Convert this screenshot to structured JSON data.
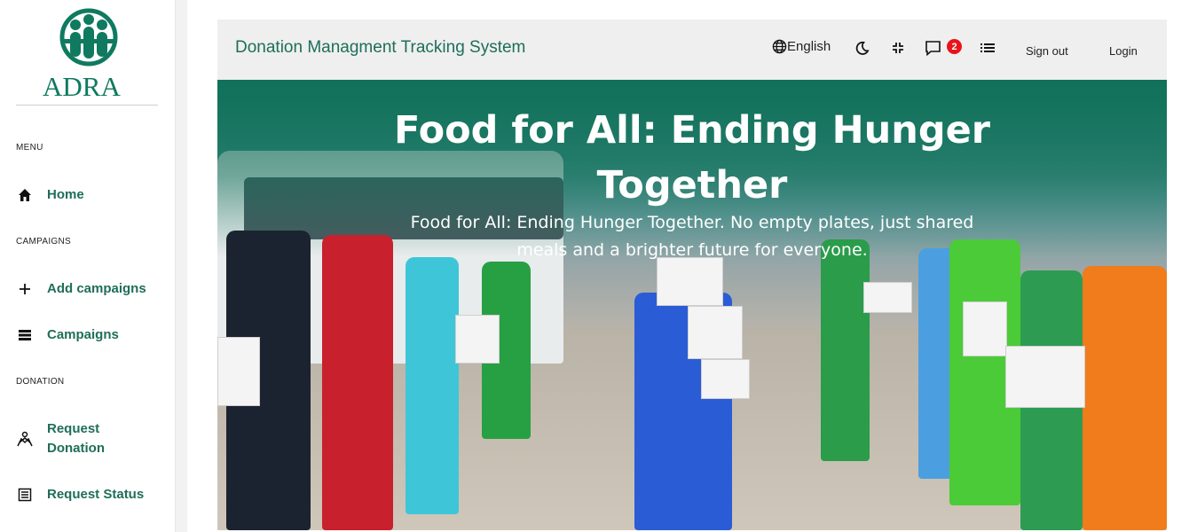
{
  "logo": {
    "brand_text": "ADRA",
    "colors": {
      "brand": "#0f7a60"
    }
  },
  "sidebar": {
    "sections": [
      {
        "label": "MENU"
      },
      {
        "label": "CAMPAIGNS"
      },
      {
        "label": "DONATION"
      }
    ],
    "items": [
      {
        "label": "Home",
        "icon": "home-icon"
      },
      {
        "label": "Add campaigns",
        "icon": "plus-icon"
      },
      {
        "label": "Campaigns",
        "icon": "list-icon"
      },
      {
        "label": "Request Donation",
        "icon": "hands-icon"
      },
      {
        "label": "Request Status",
        "icon": "table-icon"
      }
    ]
  },
  "header": {
    "title": "Donation Managment Tracking System",
    "language": "English",
    "notification_count": "2",
    "sign_out": "Sign out",
    "login": "Login"
  },
  "hero": {
    "title": "Food for All: Ending Hunger Together",
    "subtitle": "Food for All: Ending Hunger Together. No empty plates, just shared meals and a brighter future for everyone."
  },
  "colors": {
    "accent": "#1f6e58",
    "badge": "#e8141b"
  }
}
